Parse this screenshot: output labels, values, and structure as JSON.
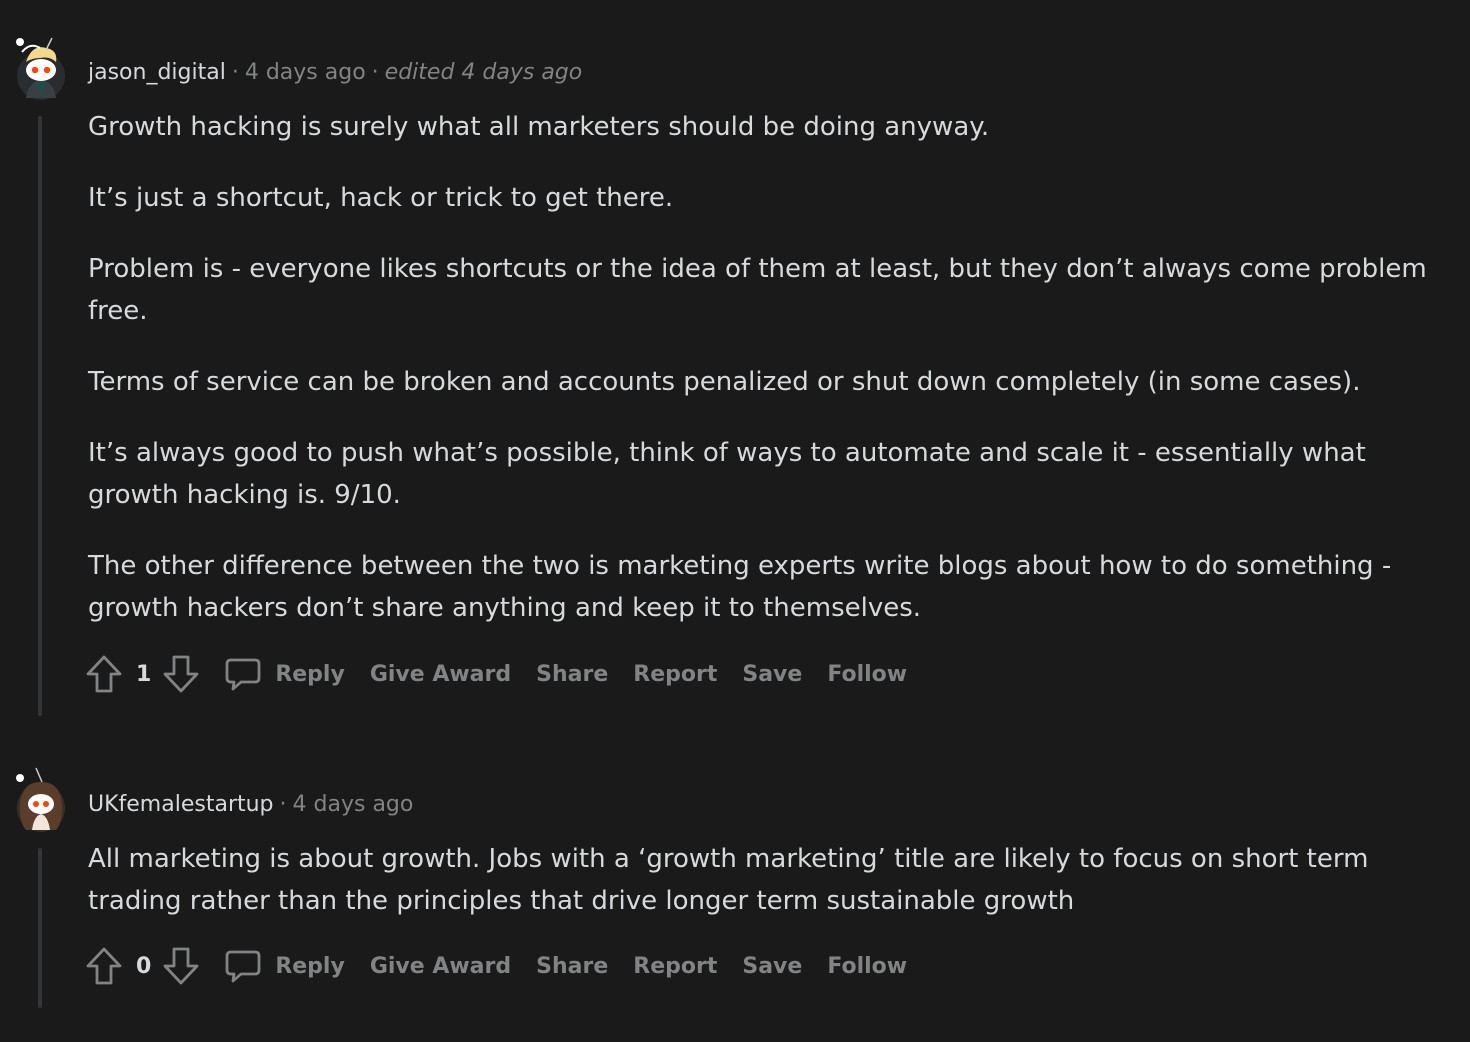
{
  "comments": [
    {
      "username": "jason_digital",
      "time": "4 days ago",
      "edited": "edited 4 days ago",
      "paragraphs": [
        "Growth hacking is surely what all marketers should be doing anyway.",
        "It’s just a shortcut, hack or trick to get there.",
        "Problem is - everyone likes shortcuts or the idea of them at least, but they don’t always come problem free.",
        "Terms of service can be broken and accounts penalized or shut down completely (in some cases).",
        "It’s always good to push what’s possible, think of ways to automate and scale it - essentially what growth hacking is. 9/10.",
        "The other difference between the two is marketing experts write blogs about how to do something - growth hackers don’t share anything and keep it to themselves."
      ],
      "votes": "1"
    },
    {
      "username": "UKfemalestartup",
      "time": "4 days ago",
      "paragraphs": [
        "All marketing is about growth. Jobs with a ‘growth marketing’ title are likely to focus on short term trading rather than the principles that drive longer term sustainable growth"
      ],
      "votes": "0"
    }
  ],
  "actions": {
    "reply": "Reply",
    "give_award": "Give Award",
    "share": "Share",
    "report": "Report",
    "save": "Save",
    "follow": "Follow"
  },
  "separator": "·",
  "colors": {
    "background": "#1a1a1b",
    "text": "#d7dadc",
    "muted": "#818384",
    "thread_line": "#343536"
  },
  "icons": {
    "upvote": "arrow-up-outline-icon",
    "downvote": "arrow-down-outline-icon",
    "comment": "speech-bubble-icon",
    "avatar": "snoo-avatar"
  }
}
